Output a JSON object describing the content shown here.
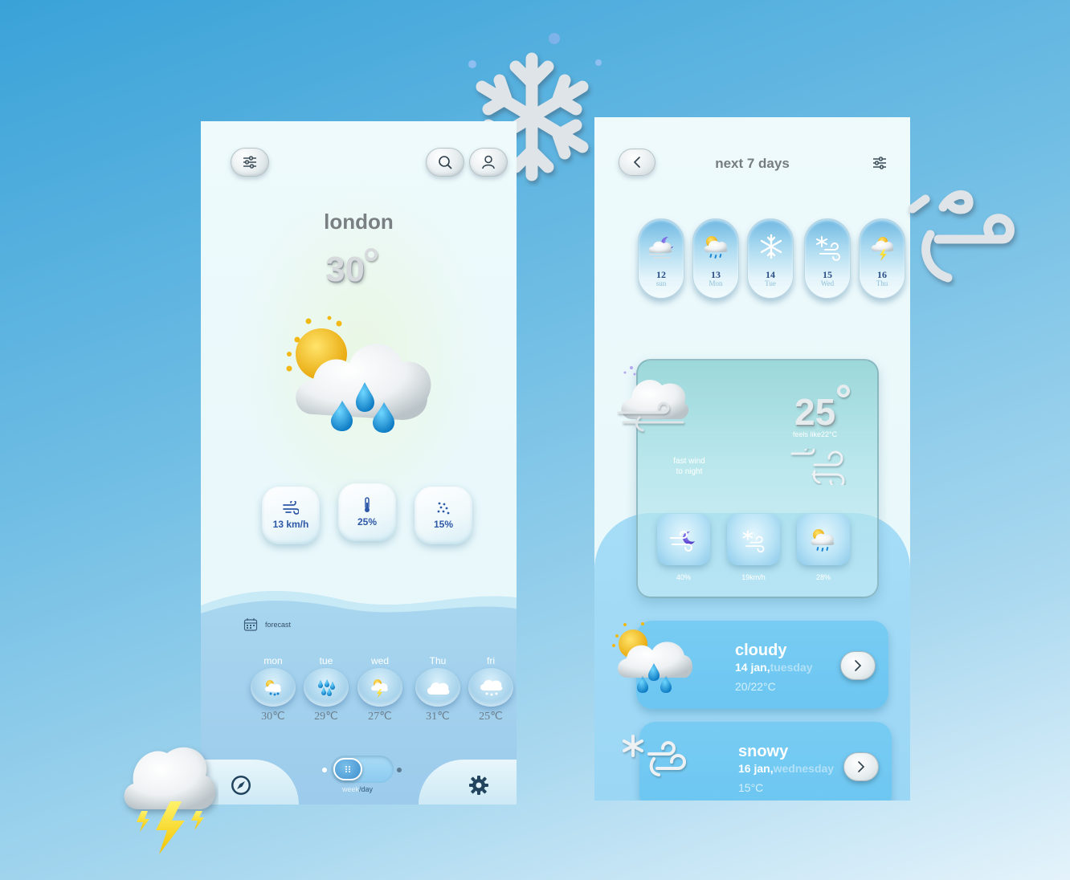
{
  "left_screen": {
    "city": "london",
    "temperature": "30",
    "stats": [
      {
        "icon": "wind-icon",
        "value": "13 km/h"
      },
      {
        "icon": "thermometer-icon",
        "value": "25%"
      },
      {
        "icon": "rain-drops-icon",
        "value": "15%"
      }
    ],
    "forecast_label": "forecast",
    "days": [
      {
        "name": "mon",
        "icon": "sun-rain-cloud-icon",
        "temp": "30℃"
      },
      {
        "name": "tue",
        "icon": "rain-icon",
        "temp": "29℃"
      },
      {
        "name": "wed",
        "icon": "thunder-cloud-icon",
        "temp": "27℃"
      },
      {
        "name": "Thu",
        "icon": "cloud-icon",
        "temp": "31℃"
      },
      {
        "name": "fri",
        "icon": "snow-cloud-icon",
        "temp": "25℃"
      }
    ],
    "toggle": {
      "left": "week",
      "sep": "/",
      "right": "day"
    }
  },
  "right_screen": {
    "title": "next 7 days",
    "days": [
      {
        "num": "12",
        "weekday": "sun",
        "icon": "night-wind-icon"
      },
      {
        "num": "13",
        "weekday": "Mon",
        "icon": "sun-rain-icon"
      },
      {
        "num": "14",
        "weekday": "Tue",
        "icon": "snowflake-icon"
      },
      {
        "num": "15",
        "weekday": "Wed",
        "icon": "snow-wind-icon"
      },
      {
        "num": "16",
        "weekday": "Thu",
        "icon": "thunder-sun-icon"
      }
    ],
    "now": {
      "temperature": "25",
      "feels_like": "feels like22°C",
      "description_line1": "fast wind",
      "description_line2": "to night",
      "details": [
        {
          "icon": "night-wind-icon",
          "value": "40%"
        },
        {
          "icon": "snow-wind-icon",
          "value": "19km/h"
        },
        {
          "icon": "sun-rain-icon",
          "value": "28%"
        }
      ]
    },
    "list": [
      {
        "title": "cloudy",
        "date_bold": "14 jan,",
        "date_dim": "tuesday",
        "range": "20/22°C"
      },
      {
        "title": "snowy",
        "date_bold": "16 jan,",
        "date_dim": "wednesday",
        "range": "15°C"
      }
    ]
  },
  "colors": {
    "background": "#3aa2d8",
    "accent": "#2d58a8",
    "card_blue": "#78ccf3"
  }
}
